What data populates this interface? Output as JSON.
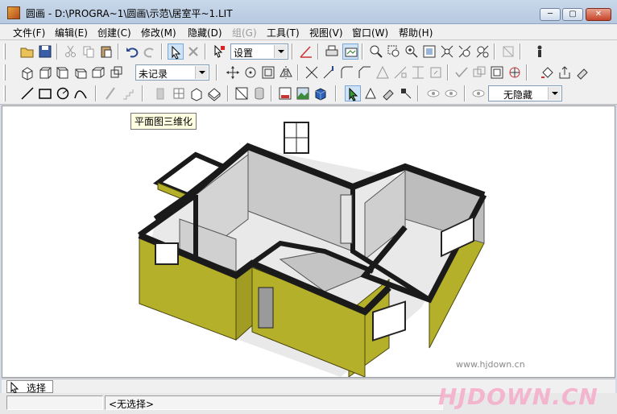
{
  "window": {
    "title": "圆画 - D:\\PROGRA~1\\圆画\\示范\\居室平~1.LIT",
    "min_glyph": "─",
    "max_glyph": "▢",
    "close_glyph": "✕"
  },
  "menu": [
    {
      "label": "文件(F)",
      "enabled": true
    },
    {
      "label": "编辑(E)",
      "enabled": true
    },
    {
      "label": "创建(C)",
      "enabled": true
    },
    {
      "label": "修改(M)",
      "enabled": true
    },
    {
      "label": "隐藏(D)",
      "enabled": true
    },
    {
      "label": "组(G)",
      "enabled": false
    },
    {
      "label": "工具(T)",
      "enabled": true
    },
    {
      "label": "视图(V)",
      "enabled": true
    },
    {
      "label": "窗口(W)",
      "enabled": true
    },
    {
      "label": "帮助(H)",
      "enabled": true
    }
  ],
  "toolbar": {
    "settings_combo": "设置",
    "record_combo": "未记录",
    "hide_combo": "无隐藏"
  },
  "tooltip": "平面图三维化",
  "command_bar": {
    "tab_label": "选择"
  },
  "status": {
    "selection": "<无选择>"
  },
  "watermark": {
    "url": "www.hjdown.cn",
    "logo": "HJDOWN.CN"
  },
  "colors": {
    "wall_exterior": "#b5b02a",
    "wall_top": "#1a1a1a",
    "interior_wall": "#c9c9c9",
    "floor": "#ffffff",
    "title_bar": "#c9d8ea"
  }
}
